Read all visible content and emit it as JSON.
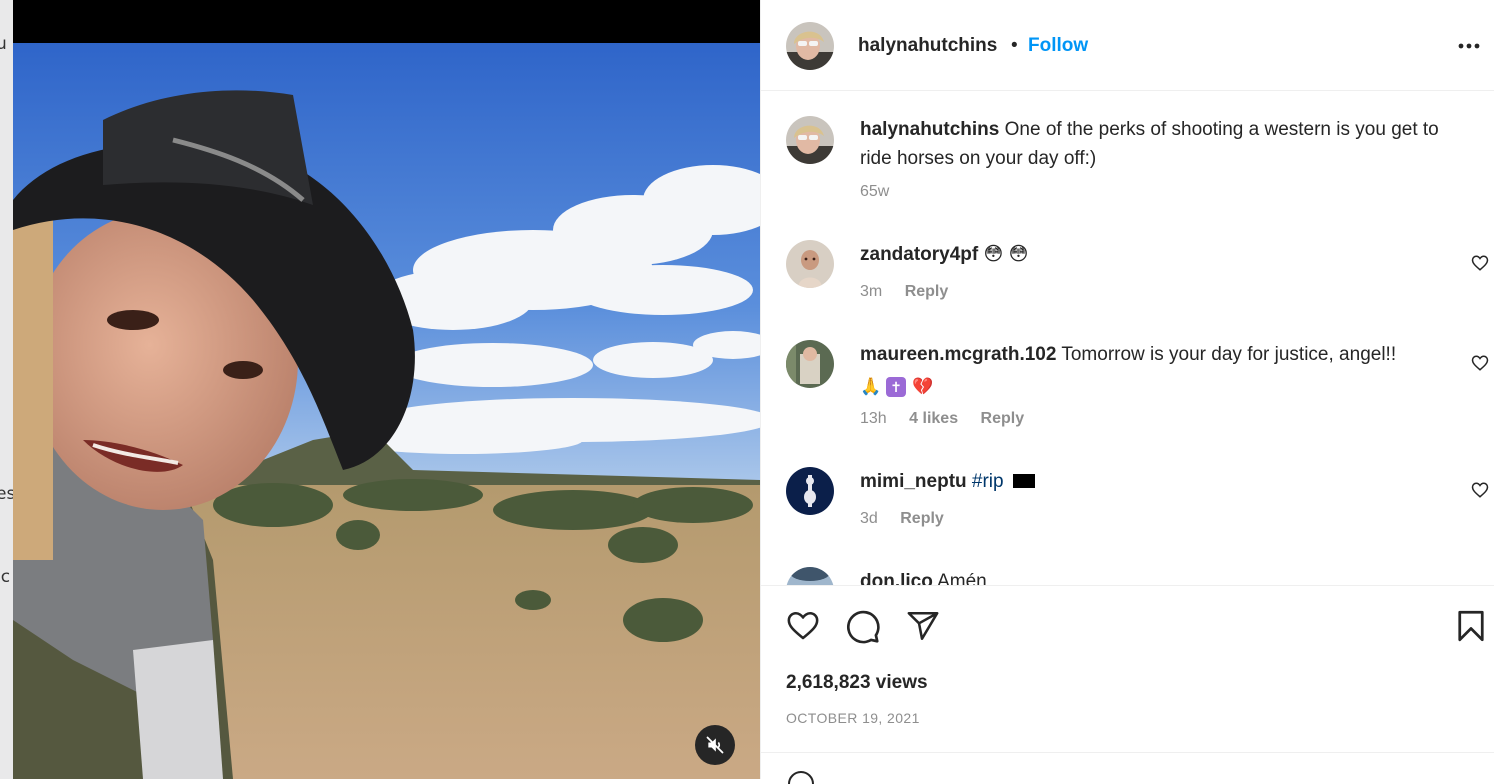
{
  "left_strip": {
    "fragments": [
      "u",
      "es",
      "ic"
    ]
  },
  "post": {
    "username": "halynahutchins",
    "follow_label": "Follow",
    "caption": "One of the perks of shooting a western is you get to ride horses on your day off:)",
    "caption_time": "65w",
    "views": "2,618,823 views",
    "date": "OCTOBER 19, 2021"
  },
  "comments": [
    {
      "username": "zandatory4pf",
      "text": "",
      "emoji": [
        "😳",
        "😳"
      ],
      "time": "3m",
      "likes": "",
      "reply": "Reply"
    },
    {
      "username": "maureen.mcgrath.102",
      "text": "Tomorrow is your day for justice, angel!!",
      "emoji": [
        "🙏",
        "✝",
        "💔"
      ],
      "time": "13h",
      "likes": "4 likes",
      "reply": "Reply"
    },
    {
      "username": "mimi_neptu",
      "hashtag": "#rip",
      "emoji": [
        "■"
      ],
      "time": "3d",
      "likes": "",
      "reply": "Reply"
    },
    {
      "username": "don.lico",
      "text": "Amén",
      "partial": true
    }
  ],
  "icons": {
    "more": "more-options-icon",
    "like": "heart-icon",
    "comment": "comment-bubble-icon",
    "share": "send-icon",
    "save": "bookmark-icon",
    "mute": "muted-speaker-icon"
  },
  "colors": {
    "follow": "#0095f6",
    "meta": "#8e8e8e",
    "hashtag": "#00376b"
  }
}
